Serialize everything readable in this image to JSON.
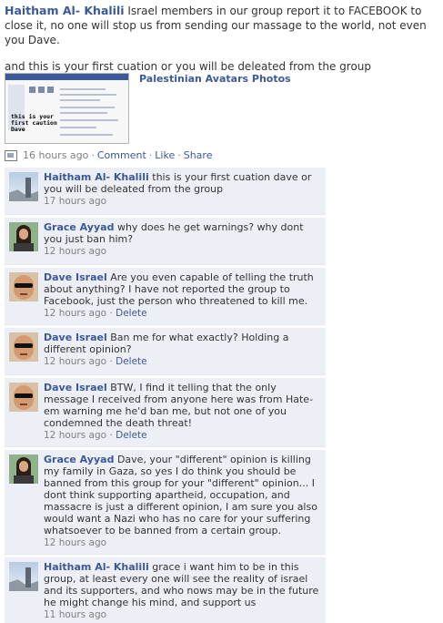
{
  "post": {
    "author": "Haitham Al- Khalili",
    "text": "Israel members in our group report it to FACEBOOK to close it, no one will stop us from sending our massage to the world, not even you Dave.",
    "line2": "and this is your first cuation or you will be deleated from the group",
    "attachment": {
      "title": "Palestinian Avatars Photos",
      "thumb_caption": "this is your first caution Dave"
    },
    "meta": {
      "time": "16 hours ago",
      "comment": "Comment",
      "like": "Like",
      "share": "Share",
      "sep": "·"
    }
  },
  "comments": [
    {
      "author": "Haitham Al- Khalili",
      "avatar": "palestine-landscape",
      "text": "this is your first cuation dave or you will be deleated from the group",
      "time": "17 hours ago",
      "delete": ""
    },
    {
      "author": "Grace Ayyad",
      "avatar": "woman-portrait",
      "text": "why does he get warnings? why dont you just ban him?",
      "time": "12 hours ago",
      "delete": ""
    },
    {
      "author": "Dave Israel",
      "avatar": "man-sunglasses",
      "text": "Are you even capable of telling the truth about anything? I have not reported the group to Facebook, just the person who threatened to kill me.",
      "time": "12 hours ago",
      "delete": "Delete"
    },
    {
      "author": "Dave Israel",
      "avatar": "man-sunglasses",
      "text": "Ban me for what exactly? Holding a different opinion?",
      "time": "12 hours ago",
      "delete": "Delete"
    },
    {
      "author": "Dave Israel",
      "avatar": "man-sunglasses",
      "text": "BTW, I find it telling that the only message I received from anyone here was from Hate-em warning me he'd ban me, but not one of you condemned the death threat!",
      "time": "12 hours ago",
      "delete": "Delete"
    },
    {
      "author": "Grace Ayyad",
      "avatar": "woman-portrait",
      "text": "Dave, your \"different\" opinion is killing my family in Gaza, so yes I do think you should be banned from this group for your \"different\" opinion... I dont think supporting apartheid, occupation, and massacre is just a different opinion, I am sure you also would want a Nazi who has no care for your suffering whatsoever to be banned from a certain group.",
      "time": "12 hours ago",
      "delete": ""
    },
    {
      "author": "Haitham Al- Khalili",
      "avatar": "palestine-landscape",
      "text": "grace i want him to be in this group, at least every one will see the reality of israel and its supporters, and who nows may be in the future he might change his mind, and support us",
      "time": "11 hours ago",
      "delete": ""
    }
  ],
  "colors": {
    "link": "#3b5998",
    "comment_bg": "#eceff5",
    "meta_gray": "#808080"
  }
}
